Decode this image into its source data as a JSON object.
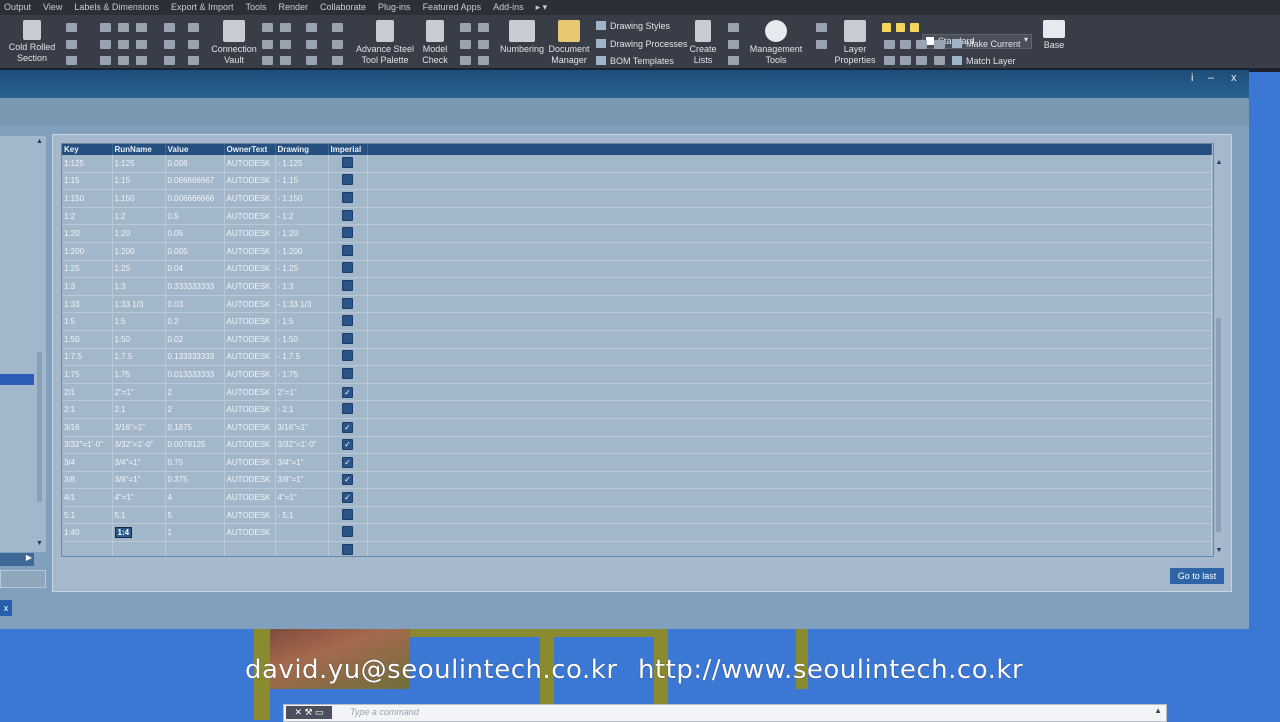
{
  "menubar": [
    "Output",
    "View",
    "Labels & Dimensions",
    "Export & Import",
    "Tools",
    "Render",
    "Collaborate",
    "Plug-ins",
    "Featured Apps",
    "Add-ins",
    "▸ ▾"
  ],
  "ribbon": {
    "cold_rolled": "Cold Rolled\nSection",
    "connection_vault": "Connection\nVault",
    "advance_steel_palette": "Advance Steel\nTool Palette",
    "model_check": "Model\nCheck",
    "numbering": "Numbering",
    "document_manager": "Document\nManager",
    "drawing_styles": "Drawing Styles",
    "drawing_processes": "Drawing Processes",
    "bom_templates": "BOM Templates",
    "create_lists": "Create\nLists",
    "management_tools": "Management\nTools",
    "layer_properties": "Layer\nProperties",
    "layer_current": "Standard",
    "make_current": "Make Current",
    "match_layer": "Match Layer",
    "base": "Base"
  },
  "dialog": {
    "controls": {
      "info": "i",
      "minimize": "–",
      "close": "x"
    },
    "goto_last": "Go to last",
    "close_side": "x"
  },
  "table": {
    "columns": [
      "Key",
      "RunName",
      "Value",
      "OwnerText",
      "Drawing",
      "Imperial"
    ],
    "rows": [
      {
        "key": "1:125",
        "runname": "1:125",
        "value": "0.008",
        "owner": "AUTODESK",
        "drawing": "- 1:125",
        "imperial": false
      },
      {
        "key": "1:15",
        "runname": "1:15",
        "value": "0.066666667",
        "owner": "AUTODESK",
        "drawing": "- 1:15",
        "imperial": false
      },
      {
        "key": "1:150",
        "runname": "1:150",
        "value": "0.006666666",
        "owner": "AUTODESK",
        "drawing": "- 1:150",
        "imperial": false
      },
      {
        "key": "1:2",
        "runname": "1:2",
        "value": "0.5",
        "owner": "AUTODESK",
        "drawing": "- 1:2",
        "imperial": false
      },
      {
        "key": "1:20",
        "runname": "1:20",
        "value": "0.05",
        "owner": "AUTODESK",
        "drawing": "- 1:20",
        "imperial": false
      },
      {
        "key": "1:200",
        "runname": "1:200",
        "value": "0.005",
        "owner": "AUTODESK",
        "drawing": "- 1:200",
        "imperial": false
      },
      {
        "key": "1:25",
        "runname": "1:25",
        "value": "0.04",
        "owner": "AUTODESK",
        "drawing": "- 1:25",
        "imperial": false
      },
      {
        "key": "1:3",
        "runname": "1:3",
        "value": "0.333333333",
        "owner": "AUTODESK",
        "drawing": "- 1:3",
        "imperial": false
      },
      {
        "key": "1:33",
        "runname": "1:33 1/3",
        "value": "0.03",
        "owner": "AUTODESK",
        "drawing": "- 1:33 1/3",
        "imperial": false
      },
      {
        "key": "1:5",
        "runname": "1:5",
        "value": "0.2",
        "owner": "AUTODESK",
        "drawing": "- 1:5",
        "imperial": false
      },
      {
        "key": "1:50",
        "runname": "1:50",
        "value": "0.02",
        "owner": "AUTODESK",
        "drawing": "- 1:50",
        "imperial": false
      },
      {
        "key": "1:7.5",
        "runname": "1:7.5",
        "value": "0.133333333",
        "owner": "AUTODESK",
        "drawing": "- 1:7.5",
        "imperial": false
      },
      {
        "key": "1:75",
        "runname": "1:75",
        "value": "0.013333333",
        "owner": "AUTODESK",
        "drawing": "- 1:75",
        "imperial": false
      },
      {
        "key": "2/1",
        "runname": "2\"=1\"",
        "value": "2",
        "owner": "AUTODESK",
        "drawing": "2\"=1\"",
        "imperial": true
      },
      {
        "key": "2:1",
        "runname": "2:1",
        "value": "2",
        "owner": "AUTODESK",
        "drawing": "- 2:1",
        "imperial": false
      },
      {
        "key": "3/16",
        "runname": "3/16\"=1\"",
        "value": "0.1875",
        "owner": "AUTODESK",
        "drawing": "3/16\"=1\"",
        "imperial": true
      },
      {
        "key": "3/32\"=1'-0\"",
        "runname": "3/32\"=1'-0\"",
        "value": "0.0078125",
        "owner": "AUTODESK",
        "drawing": "3/32\"=1'-0\"",
        "imperial": true
      },
      {
        "key": "3/4",
        "runname": "3/4\"=1\"",
        "value": "0.75",
        "owner": "AUTODESK",
        "drawing": "3/4\"=1\"",
        "imperial": true
      },
      {
        "key": "3/8",
        "runname": "3/8\"=1\"",
        "value": "0.375",
        "owner": "AUTODESK",
        "drawing": "3/8\"=1\"",
        "imperial": true
      },
      {
        "key": "4/1",
        "runname": "4\"=1\"",
        "value": "4",
        "owner": "AUTODESK",
        "drawing": "4\"=1\"",
        "imperial": true
      },
      {
        "key": "5:1",
        "runname": "5:1",
        "value": "5",
        "owner": "AUTODESK",
        "drawing": "- 5:1",
        "imperial": false
      },
      {
        "key": "1:40",
        "runname": "1:4",
        "value": "1",
        "owner": "AUTODESK",
        "drawing": "",
        "imperial": false,
        "editing": true
      },
      {
        "key": "",
        "runname": "",
        "value": "",
        "owner": "",
        "drawing": "",
        "imperial": false
      }
    ]
  },
  "overlay": {
    "email": "david.yu@seoulintech.co.kr",
    "url": "http://www.seoulintech.co.kr"
  },
  "command": {
    "placeholder": "Type a command"
  }
}
